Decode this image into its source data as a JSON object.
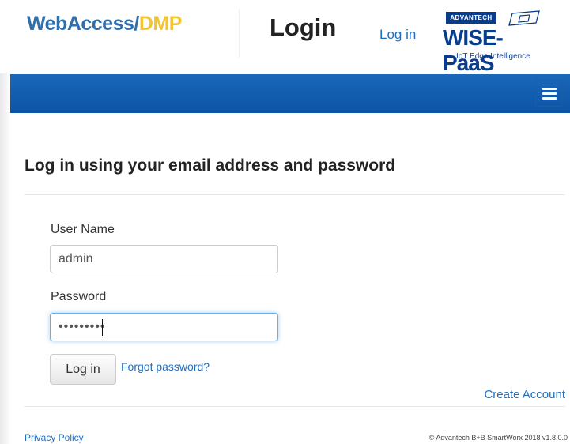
{
  "header": {
    "brand_part1": "WebAccess/",
    "brand_part2": "DMP",
    "page_title": "Login",
    "login_link": "Log in",
    "logo": {
      "company": "ADVANTECH",
      "product": "WISE-PaaS",
      "tagline": "IoT Edge Intelligence"
    }
  },
  "navbar": {
    "menu_icon": "hamburger-menu-icon",
    "color": "#1565b8"
  },
  "main": {
    "subtitle": "Log in using your email address and password",
    "username_label": "User Name",
    "username_value": "admin",
    "password_label": "Password",
    "password_value": "•••••••••",
    "login_button": "Log in",
    "forgot_password": "Forgot password?",
    "create_account": "Create Account"
  },
  "footer": {
    "privacy": "Privacy Policy",
    "copyright": "© Advantech B+B SmartWorx 2018 v1.8.0.0"
  },
  "colors": {
    "brand_blue": "#2f6fae",
    "brand_yellow": "#f3c62d",
    "link": "#1f6fc0",
    "focus": "#66afe9"
  }
}
